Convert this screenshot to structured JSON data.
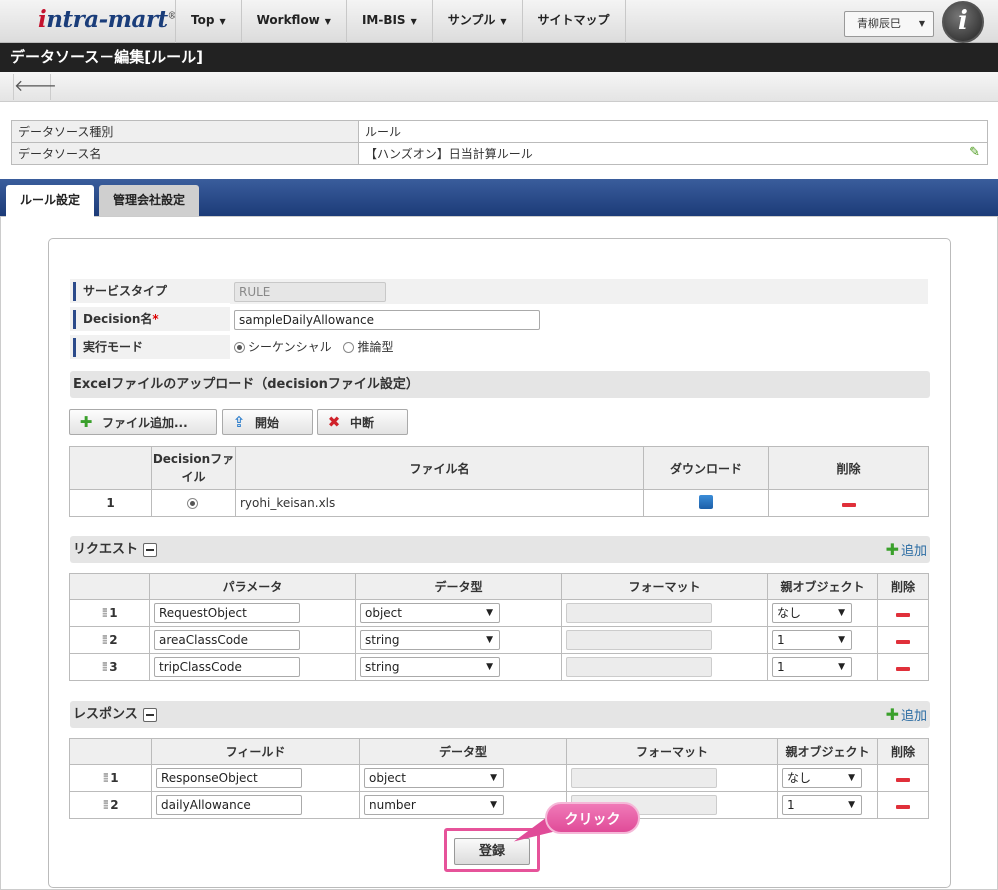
{
  "header": {
    "logo_prefix": "i",
    "logo_rest": "ntra-mart",
    "logo_mark": "®",
    "nav": [
      "Top",
      "Workflow",
      "IM-BIS",
      "サンプル",
      "サイトマップ"
    ],
    "user": "青柳辰巳",
    "caret": "▼"
  },
  "title": "データソース－編集[ルール]",
  "back_icon": "arrow-left-icon",
  "info": {
    "rows": [
      {
        "label": "データソース種別",
        "value": "ルール"
      },
      {
        "label": "データソース名",
        "value": "【ハンズオン】日当計算ルール"
      }
    ]
  },
  "tabs": {
    "active": "ルール設定",
    "inactive": "管理会社設定"
  },
  "form": {
    "service_type_label": "サービスタイプ",
    "service_type_value": "RULE",
    "decision_label": "Decision名",
    "required_mark": "*",
    "decision_value": "sampleDailyAllowance",
    "mode_label": "実行モード",
    "mode_options": [
      "シーケンシャル",
      "推論型"
    ]
  },
  "upload": {
    "section_title": "Excelファイルのアップロード（decisionファイル設定）",
    "buttons": {
      "add": "ファイル追加...",
      "start": "開始",
      "stop": "中断"
    },
    "columns": [
      "",
      "Decisionファイル",
      "ファイル名",
      "ダウンロード",
      "削除"
    ],
    "rows": [
      {
        "no": "1",
        "file": "ryohi_keisan.xls"
      }
    ]
  },
  "request": {
    "section_title": "リクエスト",
    "add_label": "追加",
    "columns": [
      "",
      "パラメータ",
      "データ型",
      "フォーマット",
      "親オブジェクト",
      "削除"
    ],
    "rows": [
      {
        "no": "1",
        "param": "RequestObject",
        "type": "object",
        "parent": "なし"
      },
      {
        "no": "2",
        "param": "areaClassCode",
        "type": "string",
        "parent": "1"
      },
      {
        "no": "3",
        "param": "tripClassCode",
        "type": "string",
        "parent": "1"
      }
    ]
  },
  "response": {
    "section_title": "レスポンス",
    "add_label": "追加",
    "columns": [
      "",
      "フィールド",
      "データ型",
      "フォーマット",
      "親オブジェクト",
      "削除"
    ],
    "rows": [
      {
        "no": "1",
        "field": "ResponseObject",
        "type": "object",
        "parent": "なし"
      },
      {
        "no": "2",
        "field": "dailyAllowance",
        "type": "number",
        "parent": "1"
      }
    ]
  },
  "submit_label": "登録",
  "callout": "クリック",
  "colors": {
    "accent": "#2b4a8a",
    "highlight": "#e6539a",
    "delete": "#e0303a"
  }
}
